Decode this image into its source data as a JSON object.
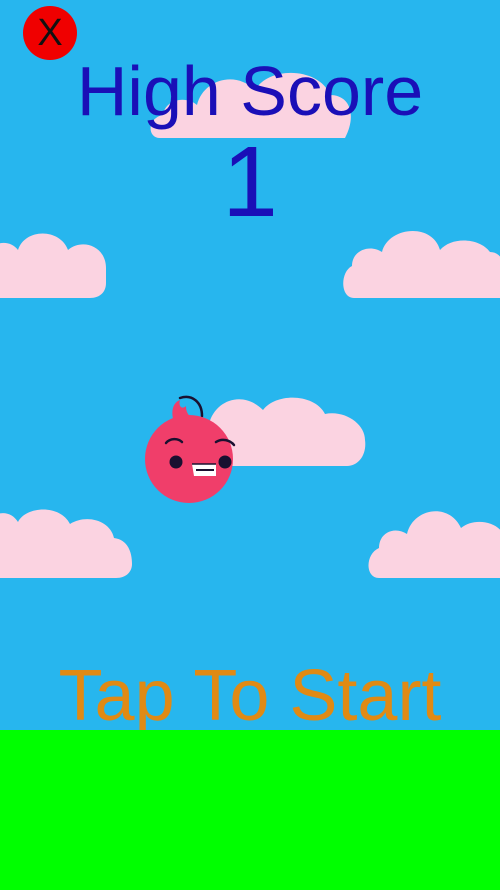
{
  "game": {
    "close_label": "X",
    "high_score_label": "High Score",
    "high_score_value": "1",
    "start_prompt": "Tap To Start"
  },
  "colors": {
    "sky": "#27b6ee",
    "ground": "#00ff00",
    "high_score_text": "#1a0fb7",
    "start_prompt_text": "#e08a14",
    "close_button": "#f00000",
    "cloud": "#fbd3e1",
    "bird_body": "#f03e6a"
  },
  "icons": {
    "close": "close-icon",
    "bird": "bird-icon",
    "cloud": "cloud-icon"
  }
}
